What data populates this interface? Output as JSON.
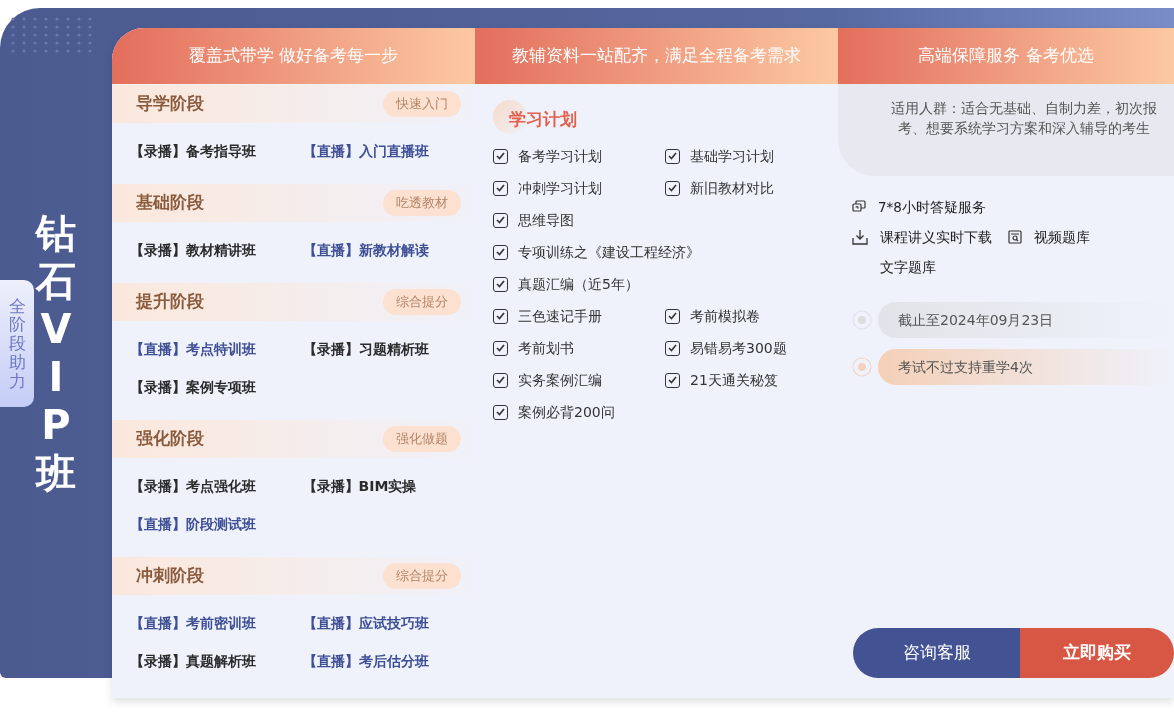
{
  "sidebar": {
    "title": "钻石VIP班",
    "tab": "全阶段助力"
  },
  "columns": [
    {
      "header": "覆盖式带学 做好备考每一步"
    },
    {
      "header": "教辅资料一站配齐，满足全程备考需求"
    },
    {
      "header": "高端保障服务 备考优选"
    }
  ],
  "stages": [
    {
      "title": "导学阶段",
      "tag": "快速入门",
      "courses": [
        {
          "kind": "recorded",
          "label": "【录播】备考指导班"
        },
        {
          "kind": "live",
          "label": "【直播】入门直播班"
        }
      ]
    },
    {
      "title": "基础阶段",
      "tag": "吃透教材",
      "courses": [
        {
          "kind": "recorded",
          "label": "【录播】教材精讲班"
        },
        {
          "kind": "live",
          "label": "【直播】新教材解读"
        }
      ]
    },
    {
      "title": "提升阶段",
      "tag": "综合提分",
      "courses": [
        {
          "kind": "live",
          "label": "【直播】考点特训班"
        },
        {
          "kind": "recorded",
          "label": "【录播】习题精析班"
        },
        {
          "kind": "recorded",
          "label": "【录播】案例专项班"
        }
      ]
    },
    {
      "title": "强化阶段",
      "tag": "强化做题",
      "courses": [
        {
          "kind": "recorded",
          "label": "【录播】考点强化班"
        },
        {
          "kind": "recorded",
          "label": "【录播】BIM实操"
        },
        {
          "kind": "live",
          "label": "【直播】阶段测试班"
        }
      ]
    },
    {
      "title": "冲刺阶段",
      "tag": "综合提分",
      "courses": [
        {
          "kind": "live",
          "label": "【直播】考前密训班"
        },
        {
          "kind": "live",
          "label": "【直播】应试技巧班"
        },
        {
          "kind": "recorded",
          "label": "【录播】真题解析班"
        },
        {
          "kind": "live",
          "label": "【直播】考后估分班"
        }
      ]
    }
  ],
  "materials": {
    "title": "学习计划",
    "rows": [
      [
        {
          "label": "备考学习计划",
          "checked": true
        },
        {
          "label": "基础学习计划",
          "checked": true
        }
      ],
      [
        {
          "label": "冲刺学习计划",
          "checked": true
        },
        {
          "label": "新旧教材对比",
          "checked": true
        }
      ],
      [
        {
          "label": "思维导图",
          "checked": true
        }
      ],
      [
        {
          "label": "专项训练之《建设工程经济》",
          "checked": true
        }
      ],
      [
        {
          "label": "真题汇编（近5年）",
          "checked": true
        }
      ],
      [
        {
          "label": "三色速记手册",
          "checked": true
        },
        {
          "label": "考前模拟卷",
          "checked": true
        }
      ],
      [
        {
          "label": "考前划书",
          "checked": true
        },
        {
          "label": "易错易考300题",
          "checked": true
        }
      ],
      [
        {
          "label": "实务案例汇编",
          "checked": true
        },
        {
          "label": "21天通关秘笈",
          "checked": true
        }
      ],
      [
        {
          "label": "案例必背200问",
          "checked": true
        }
      ]
    ]
  },
  "service": {
    "audience": "适用人群：适合无基础、自制力差，初次报考、想要系统学习方案和深入辅导的考生",
    "benefits": [
      [
        {
          "kind": "chat",
          "label": "7*8小时答疑服务"
        }
      ],
      [
        {
          "kind": "download",
          "label": "课程讲义实时下载"
        },
        {
          "kind": "video",
          "label": "视频题库"
        }
      ],
      [
        {
          "kind": "none",
          "label": "文字题库"
        }
      ]
    ],
    "notes": [
      {
        "kind": "deadline",
        "label": "截止至2024年09月23日"
      },
      {
        "kind": "retake",
        "label": "考试不过支持重学4次"
      }
    ],
    "buttons": [
      {
        "kind": "secondary",
        "label": "咨询客服"
      },
      {
        "kind": "primary",
        "label": "立即购买"
      }
    ]
  }
}
